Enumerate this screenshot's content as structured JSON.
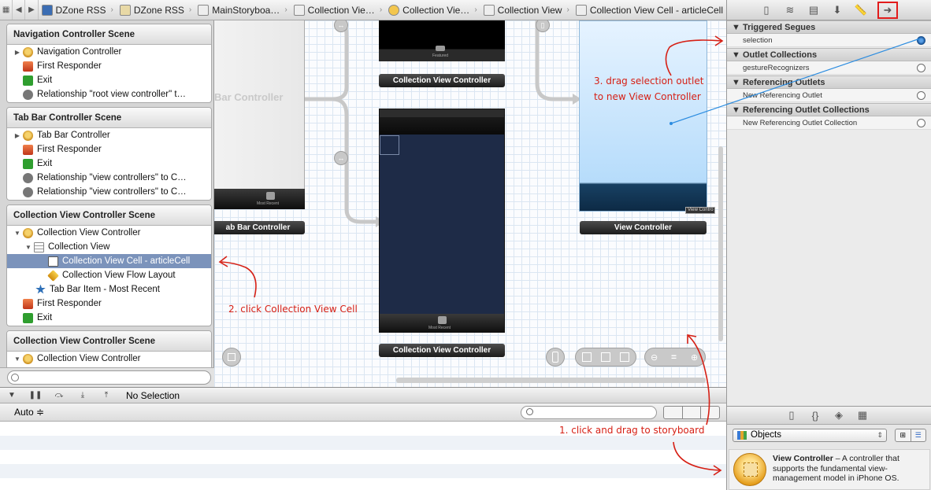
{
  "jumpbar": {
    "breadcrumbs": [
      "DZone RSS",
      "DZone RSS",
      "MainStoryboa…",
      "Collection Vie…",
      "Collection Vie…",
      "Collection View",
      "Collection View Cell - articleCell"
    ]
  },
  "outline": {
    "scenes": [
      {
        "title": "Navigation Controller Scene",
        "rows": [
          "Navigation Controller",
          "First Responder",
          "Exit",
          "Relationship \"root view controller\" t…"
        ]
      },
      {
        "title": "Tab Bar Controller Scene",
        "rows": [
          "Tab Bar Controller",
          "First Responder",
          "Exit",
          "Relationship \"view controllers\" to C…",
          "Relationship \"view controllers\" to C…"
        ]
      },
      {
        "title": "Collection View Controller Scene",
        "rows": [
          "Collection View Controller",
          "Collection View",
          "Collection View Cell - articleCell",
          "Collection View Flow Layout",
          "Tab Bar Item - Most Recent",
          "First Responder",
          "Exit"
        ]
      },
      {
        "title": "Collection View Controller Scene",
        "rows": [
          "Collection View Controller"
        ]
      }
    ]
  },
  "canvas": {
    "tab_bar_ghost": "Bar Controller",
    "tab_bar_label": "ab Bar Controller",
    "most_recent": "Most Recent",
    "featured": "Featured",
    "cvc_top_label": "Collection View Controller",
    "cvc_bottom_label": "Collection View Controller",
    "vc_label": "View Controller",
    "vc_tag": "View Contro"
  },
  "debug": {
    "status": "No Selection"
  },
  "console": {
    "mode": "Auto ≑"
  },
  "inspector": {
    "sections": [
      {
        "title": "Triggered Segues",
        "rows": [
          "selection"
        ]
      },
      {
        "title": "Outlet Collections",
        "rows": [
          "gestureRecognizers"
        ]
      },
      {
        "title": "Referencing Outlets",
        "rows": [
          "New Referencing Outlet"
        ]
      },
      {
        "title": "Referencing Outlet Collections",
        "rows": [
          "New Referencing Outlet Collection"
        ]
      }
    ]
  },
  "library": {
    "dropdown": "Objects",
    "item_title": "View Controller",
    "item_desc": " – A controller that supports the fundamental view-management model in iPhone OS."
  },
  "annotations": {
    "step1": "1. click and drag to storyboard",
    "step2": "2. click Collection View Cell",
    "step3_line1": "3. drag selection outlet",
    "step3_line2": "to new View Controller"
  },
  "colors": {
    "annotation": "#d62015",
    "selection": "#7b93bb",
    "connector": "#2b8ce0"
  }
}
